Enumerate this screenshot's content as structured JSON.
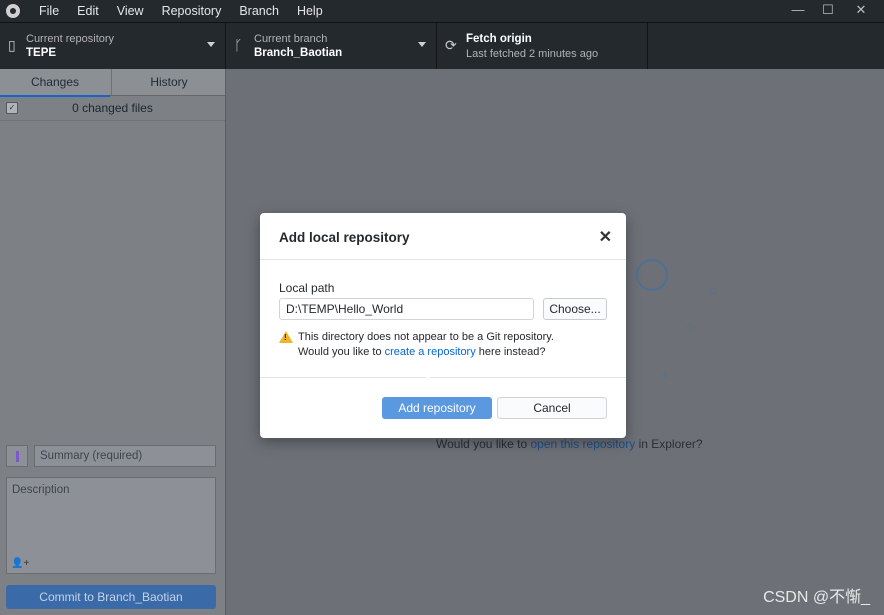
{
  "menu": [
    "File",
    "Edit",
    "View",
    "Repository",
    "Branch",
    "Help"
  ],
  "window_controls": {
    "minimize": "—",
    "maximize": "☐",
    "close": "✕"
  },
  "toolbar": {
    "repo": {
      "label": "Current repository",
      "value": "TEPE"
    },
    "branch": {
      "label": "Current branch",
      "value": "Branch_Baotian"
    },
    "fetch": {
      "label": "Fetch origin",
      "sub": "Last fetched 2 minutes ago"
    }
  },
  "sidebar": {
    "tabs": [
      "Changes",
      "History"
    ],
    "changed_files": "0 changed files",
    "summary_placeholder": "Summary (required)",
    "description_placeholder": "Description",
    "commit_button": "Commit to Branch_Baotian"
  },
  "main": {
    "hint_prefix": "Would you like to ",
    "hint_link": "open this repository",
    "hint_suffix": " in Explorer?"
  },
  "dialog": {
    "title": "Add local repository",
    "close_glyph": "✕",
    "local_path_label": "Local path",
    "local_path_value": "D:\\TEMP\\Hello_World",
    "choose_button": "Choose...",
    "warning_line1": "This directory does not appear to be a Git repository.",
    "warning_line2_prefix": "Would you like to ",
    "warning_link": "create a repository",
    "warning_line2_suffix": " here instead?",
    "add_button": "Add repository",
    "cancel_button": "Cancel"
  },
  "watermark": "CSDN @不惭_",
  "colors": {
    "accent": "#5a98e0",
    "warning": "#f0b429",
    "link": "#0366d6"
  }
}
